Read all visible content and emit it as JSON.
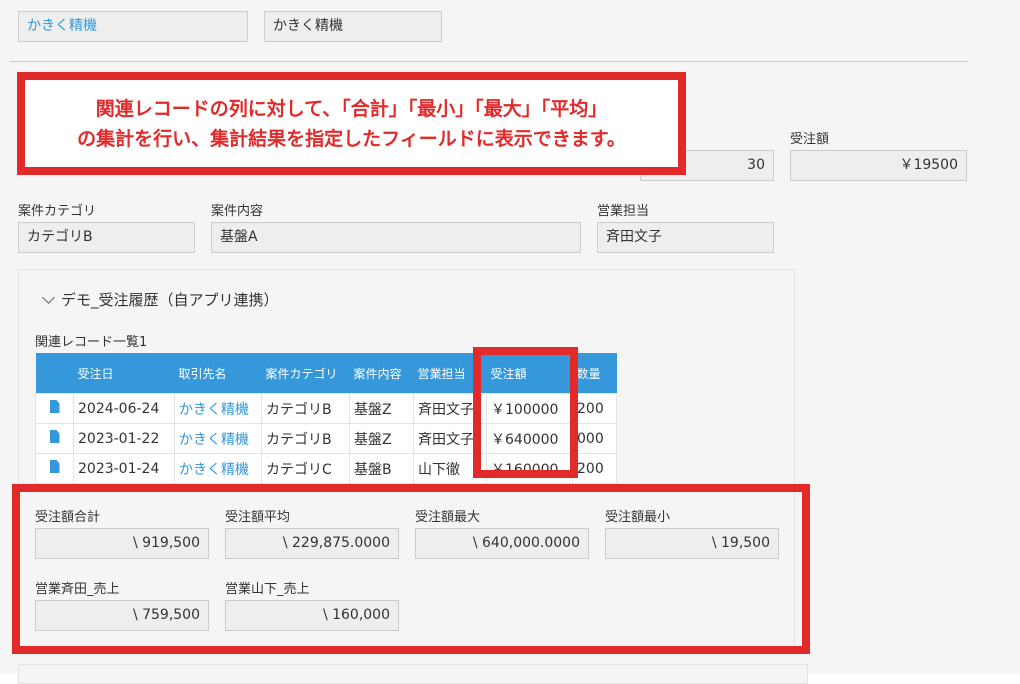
{
  "top": {
    "field1_value": "かきく精機",
    "field2_value": "かきく精機",
    "quantity_value": "30",
    "amount_label": "受注額",
    "amount_value": "￥19500"
  },
  "callout": {
    "line1": "関連レコードの列に対して、「合計」「最小」「最大」「平均」",
    "line2": "の集計を行い、集計結果を指定したフィールドに表示できます。"
  },
  "fields": {
    "category_label": "案件カテゴリ",
    "category_value": "カテゴリB",
    "content_label": "案件内容",
    "content_value": "基盤A",
    "sales_label": "営業担当",
    "sales_value": "斉田文子"
  },
  "group": {
    "title": "デモ_受注履歴（自アプリ連携）",
    "related_label": "関連レコード一覧1"
  },
  "table": {
    "headers": [
      "受注日",
      "取引先名",
      "案件カテゴリ",
      "案件内容",
      "営業担当",
      "受注額",
      "数量"
    ],
    "rows": [
      [
        "2024-06-24",
        "かきく精機",
        "カテゴリB",
        "基盤Z",
        "斉田文子",
        "￥100000",
        "200"
      ],
      [
        "2023-01-22",
        "かきく精機",
        "カテゴリB",
        "基盤Z",
        "斉田文子",
        "￥640000",
        "000"
      ],
      [
        "2023-01-24",
        "かきく精機",
        "カテゴリC",
        "基盤B",
        "山下徹",
        "￥160000",
        "200"
      ]
    ]
  },
  "summary": {
    "total_label": "受注額合計",
    "total_value": "\\ 919,500",
    "avg_label": "受注額平均",
    "avg_value": "\\ 229,875.0000",
    "max_label": "受注額最大",
    "max_value": "\\ 640,000.0000",
    "min_label": "受注額最小",
    "min_value": "\\ 19,500",
    "saida_label": "営業斉田_売上",
    "saida_value": "\\ 759,500",
    "yamashita_label": "営業山下_売上",
    "yamashita_value": "\\ 160,000"
  },
  "colors": {
    "accent": "#3498db",
    "highlight": "#e12a2a"
  }
}
